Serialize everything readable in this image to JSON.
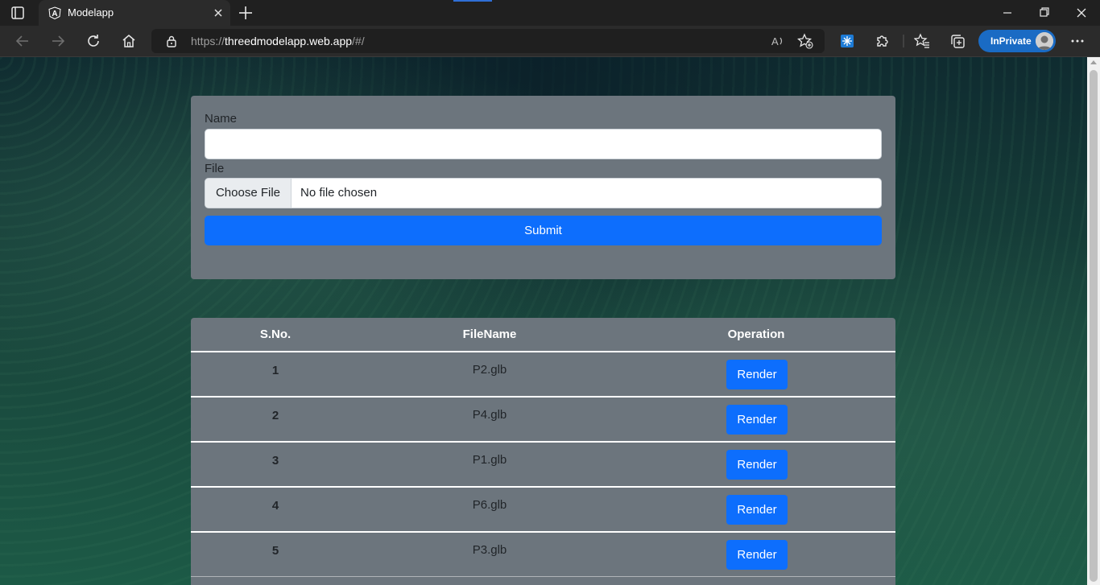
{
  "browser": {
    "tab": {
      "title": "Modelapp"
    },
    "address": {
      "scheme": "https://",
      "host": "threedmodelapp.web.app",
      "path": "/#/"
    },
    "profile": {
      "label": "InPrivate"
    }
  },
  "form": {
    "name_label": "Name",
    "name_value": "",
    "file_label": "File",
    "choose_file_label": "Choose File",
    "file_status": "No file chosen",
    "submit_label": "Submit"
  },
  "table": {
    "headers": [
      "S.No.",
      "FileName",
      "Operation"
    ],
    "rows": [
      {
        "sno": "1",
        "file": "P2.glb",
        "action": "Render"
      },
      {
        "sno": "2",
        "file": "P4.glb",
        "action": "Render"
      },
      {
        "sno": "3",
        "file": "P1.glb",
        "action": "Render"
      },
      {
        "sno": "4",
        "file": "P6.glb",
        "action": "Render"
      },
      {
        "sno": "5",
        "file": "P3.glb",
        "action": "Render"
      }
    ]
  },
  "colors": {
    "primary": "#0d6efd",
    "card": "#6c757d",
    "inprivate": "#1a6bc4"
  },
  "icons": [
    "tab-actions-icon",
    "angular-favicon-icon",
    "close-tab-icon",
    "new-tab-icon",
    "minimize-icon",
    "restore-icon",
    "close-window-icon",
    "back-icon",
    "forward-icon",
    "refresh-icon",
    "home-icon",
    "lock-icon",
    "read-aloud-icon",
    "add-favorite-icon",
    "extension-icon",
    "extensions-icon",
    "favorites-icon",
    "collections-icon",
    "more-icon"
  ]
}
